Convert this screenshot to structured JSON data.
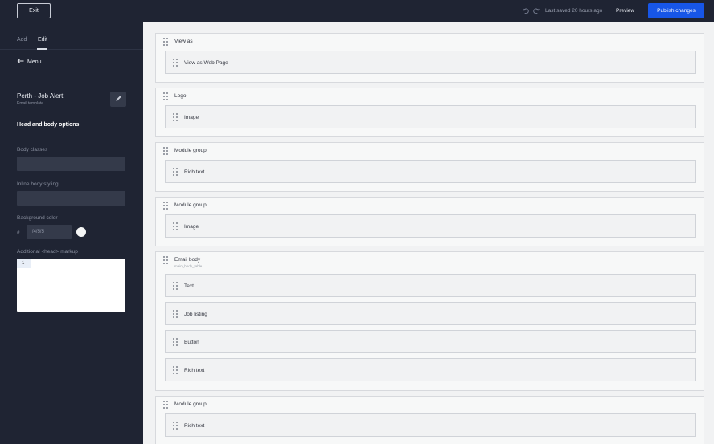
{
  "topbar": {
    "exit_label": "Exit",
    "saved_text": "Last saved 20 hours ago",
    "preview_label": "Preview",
    "publish_label": "Publish changes",
    "undo_icon": "undo-icon",
    "redo_icon": "redo-icon"
  },
  "sidebar": {
    "tabs": [
      {
        "label": "Add"
      },
      {
        "label": "Edit"
      }
    ],
    "menu_label": "Menu",
    "template": {
      "title": "Perth - Job Alert",
      "subtitle": "Email template"
    },
    "section_heading": "Head and body options",
    "body_classes_label": "Body classes",
    "inline_styling_label": "Inline body styling",
    "background_color_label": "Background color",
    "hash": "#",
    "background_color_value": "f4f5f5",
    "swatch_color": "#f4f5f5",
    "head_markup_label": "Additional <head> markup",
    "editor_line": "1"
  },
  "canvas": {
    "groups": [
      {
        "title": "View as",
        "modules": [
          "View as Web Page"
        ]
      },
      {
        "title": "Logo",
        "modules": [
          "Image"
        ]
      },
      {
        "title": "Module group",
        "modules": [
          "Rich text"
        ]
      },
      {
        "title": "Module group",
        "modules": [
          "Image"
        ]
      },
      {
        "title": "Email body",
        "subtitle": "main_body_table",
        "modules": [
          "Text",
          "Job listing",
          "Button",
          "Rich text"
        ]
      },
      {
        "title": "Module group",
        "modules": [
          "Rich text"
        ]
      }
    ]
  },
  "colors": {
    "accent": "#1756e8",
    "sidebar_bg": "#1f2433",
    "canvas_bg": "#f1f2f3"
  }
}
